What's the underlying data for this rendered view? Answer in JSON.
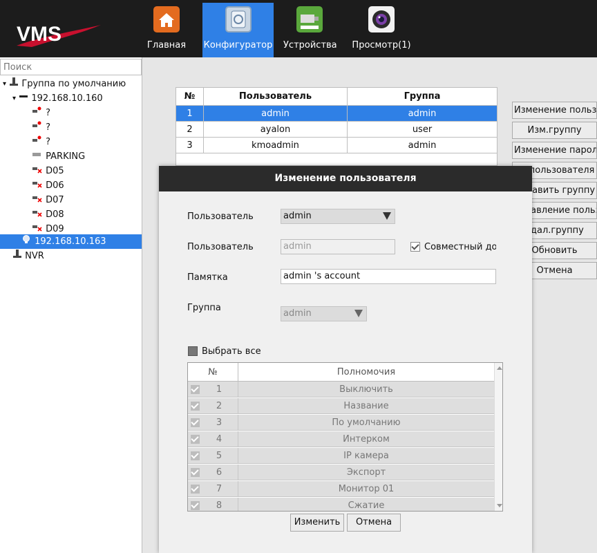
{
  "app": {
    "logo_text": "VMS",
    "accent_color": "#2f80e6"
  },
  "nav": [
    {
      "label": "Главная",
      "icon": "home-icon",
      "active": false
    },
    {
      "label": "Конфигуратор",
      "icon": "config-icon",
      "active": true
    },
    {
      "label": "Устройства",
      "icon": "camera-device-icon",
      "active": false
    },
    {
      "label": "Просмотр(1)",
      "icon": "lens-view-icon",
      "active": false
    }
  ],
  "sidebar": {
    "search_placeholder": "Поиск",
    "tree": [
      {
        "label": "Группа по умолчанию",
        "icon": "group-icon"
      },
      {
        "label": "192.168.10.160",
        "icon": "dvr-icon"
      },
      {
        "label": "?",
        "icon": "camera-alarm-icon"
      },
      {
        "label": "?",
        "icon": "camera-alarm-icon"
      },
      {
        "label": "?",
        "icon": "camera-alarm-icon"
      },
      {
        "label": "PARKING",
        "icon": "camera-icon"
      },
      {
        "label": "D05",
        "icon": "camera-offline-icon"
      },
      {
        "label": "D06",
        "icon": "camera-offline-icon"
      },
      {
        "label": "D07",
        "icon": "camera-offline-icon"
      },
      {
        "label": "D08",
        "icon": "camera-offline-icon"
      },
      {
        "label": "D09",
        "icon": "camera-offline-icon"
      },
      {
        "label": "192.168.10.163",
        "icon": "ipc-icon",
        "selected": true
      },
      {
        "label": "NVR",
        "icon": "group-icon"
      }
    ]
  },
  "users_table": {
    "headers": [
      "№",
      "Пользователь",
      "Группа"
    ],
    "rows": [
      {
        "no": "1",
        "user": "admin",
        "group": "admin",
        "selected": true
      },
      {
        "no": "2",
        "user": "ayalon",
        "group": "user"
      },
      {
        "no": "3",
        "user": "kmoadmin",
        "group": "admin"
      }
    ]
  },
  "right_buttons": [
    "Изменение пользователя",
    "Изм.группу",
    "Изменение пароля",
    "Уд.пользователя",
    "Добавить группу",
    "Добавление пользователя",
    "Удал.группу",
    "Обновить",
    "Отмена"
  ],
  "dialog": {
    "title": "Изменение пользователя",
    "user_select_label": "Пользователь",
    "user_select_value": "admin",
    "user_name_label": "Пользователь",
    "user_name_value": "admin",
    "shared_access_label": "Совместный дос",
    "memo_label": "Памятка",
    "memo_value": "admin 's account",
    "group_label": "Группа",
    "group_value": "admin",
    "select_all_label": "Выбрать все",
    "perm_headers": {
      "no": "№",
      "name": "Полномочия"
    },
    "permissions": [
      {
        "no": "1",
        "name": "Выключить"
      },
      {
        "no": "2",
        "name": "Название"
      },
      {
        "no": "3",
        "name": "По умолчанию"
      },
      {
        "no": "4",
        "name": "Интерком"
      },
      {
        "no": "5",
        "name": "IP камера"
      },
      {
        "no": "6",
        "name": "Экспорт"
      },
      {
        "no": "7",
        "name": "Монитор 01"
      },
      {
        "no": "8",
        "name": "Сжатие"
      }
    ],
    "modify_button": "Изменить",
    "cancel_button": "Отмена"
  }
}
